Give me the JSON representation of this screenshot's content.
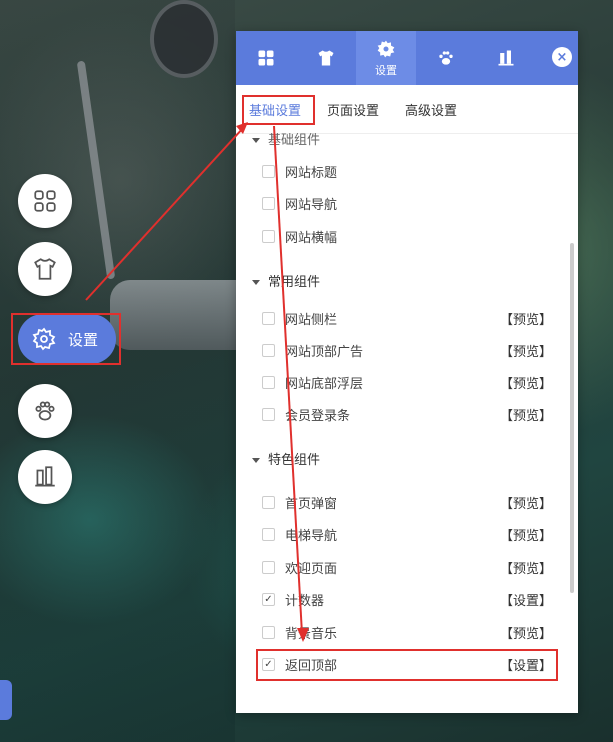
{
  "side_menu": {
    "items": [
      {
        "name": "grid-icon"
      },
      {
        "name": "shirt-icon"
      },
      {
        "name": "gear-icon",
        "label": "设置"
      },
      {
        "name": "paw-icon"
      },
      {
        "name": "widgets-icon"
      }
    ]
  },
  "panel": {
    "tabs": [
      {
        "icon": "grid-icon"
      },
      {
        "icon": "shirt-icon"
      },
      {
        "icon": "gear-icon",
        "label": "设置"
      },
      {
        "icon": "paw-icon"
      },
      {
        "icon": "widgets-icon"
      }
    ],
    "close_label": "×",
    "subtabs": [
      "基础设置",
      "页面设置",
      "高级设置"
    ],
    "groups": [
      {
        "title": "基础组件",
        "items": [
          {
            "label": "网站标题",
            "checked": false,
            "action": ""
          },
          {
            "label": "网站导航",
            "checked": false,
            "action": ""
          },
          {
            "label": "网站横幅",
            "checked": false,
            "action": ""
          }
        ]
      },
      {
        "title": "常用组件",
        "items": [
          {
            "label": "网站侧栏",
            "checked": false,
            "action": "【预览】"
          },
          {
            "label": "网站顶部广告",
            "checked": false,
            "action": "【预览】"
          },
          {
            "label": "网站底部浮层",
            "checked": false,
            "action": "【预览】"
          },
          {
            "label": "会员登录条",
            "checked": false,
            "action": "【预览】"
          }
        ]
      },
      {
        "title": "特色组件",
        "items": [
          {
            "label": "首页弹窗",
            "checked": false,
            "action": "【预览】"
          },
          {
            "label": "电梯导航",
            "checked": false,
            "action": "【预览】"
          },
          {
            "label": "欢迎页面",
            "checked": false,
            "action": "【预览】"
          },
          {
            "label": "计数器",
            "checked": true,
            "action": "【设置】"
          },
          {
            "label": "背景音乐",
            "checked": false,
            "action": "【预览】"
          },
          {
            "label": "返回顶部",
            "checked": true,
            "action": "【设置】"
          }
        ]
      }
    ]
  },
  "colors": {
    "accent": "#5b7bdc",
    "annotation": "#e0302d"
  }
}
